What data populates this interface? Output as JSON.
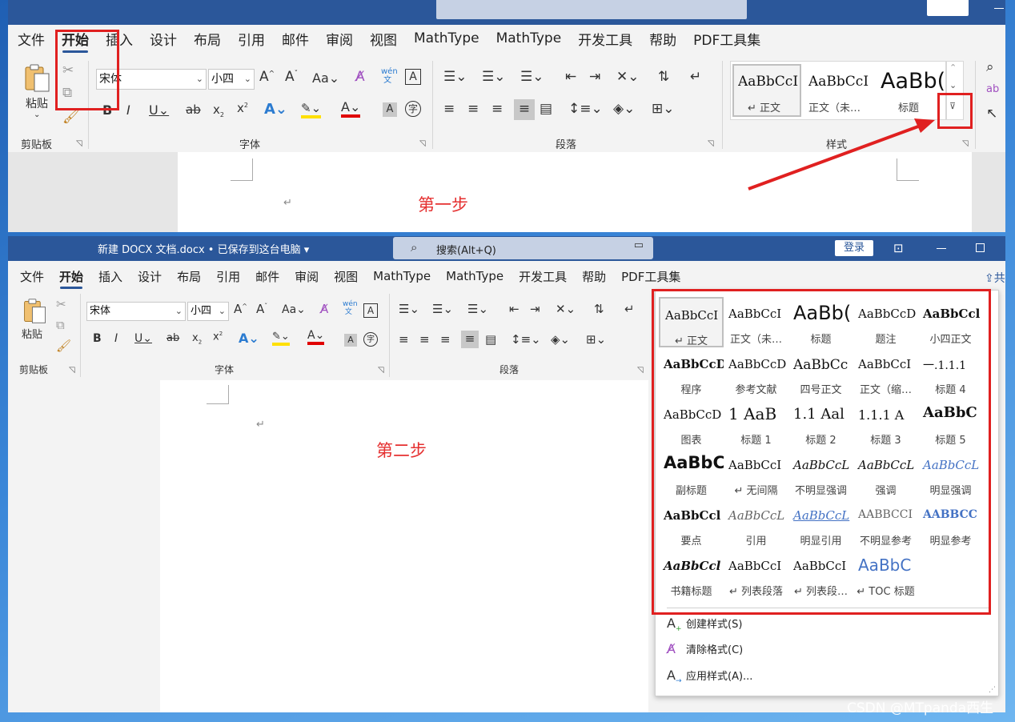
{
  "menu": [
    "文件",
    "开始",
    "插入",
    "设计",
    "布局",
    "引用",
    "邮件",
    "审阅",
    "视图",
    "MathType",
    "MathType",
    "开发工具",
    "帮助",
    "PDF工具集"
  ],
  "clipboard": {
    "paste_label": "粘贴",
    "group_label": "剪贴板"
  },
  "font": {
    "name": "宋体",
    "size": "小四",
    "group_label": "字体",
    "pinyin": "wén\n文"
  },
  "paragraph": {
    "group_label": "段落"
  },
  "styles": {
    "group_label": "样式",
    "panel1_gallery": [
      {
        "preview": "AaBbCcI",
        "name": "↵ 正文"
      },
      {
        "preview": "AaBbCcI",
        "name": "正文（未…"
      },
      {
        "preview": "AaBb(",
        "name": "标题"
      }
    ]
  },
  "document": {
    "pilcrow": "↵",
    "step1": "第一步",
    "step2": "第二步"
  },
  "titlebar": {
    "doc_title": "新建 DOCX 文档.docx • 已保存到这台电脑 ▾",
    "search": "搜索(Alt+Q)",
    "login": "登录"
  },
  "dropdown": {
    "styles": [
      {
        "preview": "AaBbCcI",
        "name": "↵ 正文"
      },
      {
        "preview": "AaBbCcI",
        "name": "正文（未…"
      },
      {
        "preview": "AaBb(",
        "name": "标题"
      },
      {
        "preview": "AaBbCcD",
        "name": "题注"
      },
      {
        "preview": "AaBbCcl",
        "name": "小四正文"
      },
      {
        "preview": "AaBbCcD",
        "name": "程序"
      },
      {
        "preview": "AaBbCcD",
        "name": "参考文献"
      },
      {
        "preview": "AaBbCc",
        "name": "四号正文"
      },
      {
        "preview": "AaBbCcI",
        "name": "正文（缩…"
      },
      {
        "preview": "一.1.1.1",
        "name": "标题 4"
      },
      {
        "preview": "AaBbCcD",
        "name": "图表"
      },
      {
        "preview": "1  AaB",
        "name": "标题 1"
      },
      {
        "preview": "1.1  Aal",
        "name": "标题 2"
      },
      {
        "preview": "1.1.1  A",
        "name": "标题 3"
      },
      {
        "preview": "AaBbC",
        "name": "标题 5"
      },
      {
        "preview": "AaBbC",
        "name": "副标题"
      },
      {
        "preview": "AaBbCcI",
        "name": "↵ 无间隔"
      },
      {
        "preview": "AaBbCcL",
        "name": "不明显强调"
      },
      {
        "preview": "AaBbCcL",
        "name": "强调"
      },
      {
        "preview": "AaBbCcL",
        "name": "明显强调"
      },
      {
        "preview": "AaBbCcl",
        "name": "要点"
      },
      {
        "preview": "AaBbCcL",
        "name": "引用"
      },
      {
        "preview": "AaBbCcL",
        "name": "明显引用"
      },
      {
        "preview": "AABBCCI",
        "name": "不明显参考"
      },
      {
        "preview": "AABBCC",
        "name": "明显参考"
      },
      {
        "preview": "AaBbCcl",
        "name": "书籍标题"
      },
      {
        "preview": "AaBbCcI",
        "name": "↵ 列表段落"
      },
      {
        "preview": "AaBbCcI",
        "name": "↵ 列表段…"
      },
      {
        "preview": "AaBbC",
        "name": "↵ TOC 标题"
      }
    ],
    "actions": [
      "创建样式(S)",
      "清除格式(C)",
      "应用样式(A)..."
    ]
  },
  "watermark": "CSDN @MTpanda西生",
  "colors": {
    "titlebar": "#2b579a",
    "highlight_red": "#e02020",
    "accent_blue": "#4472c4"
  }
}
